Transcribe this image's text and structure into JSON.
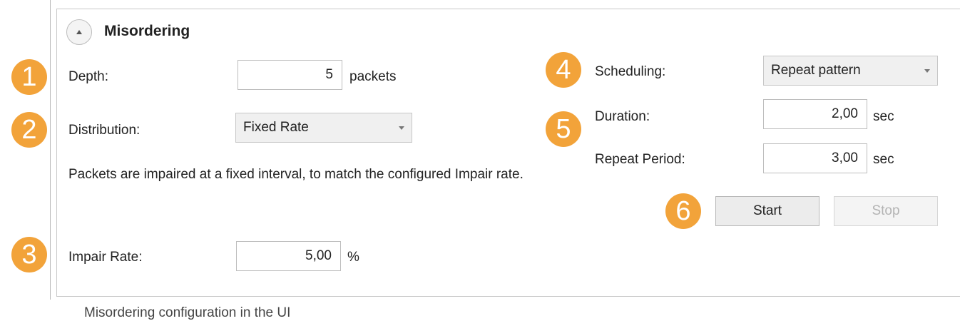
{
  "section": {
    "title": "Misordering",
    "collapse_icon": "chevron-up-icon"
  },
  "depth": {
    "label": "Depth:",
    "value": "5",
    "unit": "packets"
  },
  "distribution": {
    "label": "Distribution:",
    "selected": "Fixed Rate",
    "description": "Packets are impaired at a fixed interval, to match the configured Impair rate."
  },
  "impair_rate": {
    "label": "Impair Rate:",
    "value": "5,00",
    "unit": "%"
  },
  "scheduling": {
    "label": "Scheduling:",
    "selected": "Repeat pattern"
  },
  "duration": {
    "label": "Duration:",
    "value": "2,00",
    "unit": "sec"
  },
  "repeat_period": {
    "label": "Repeat Period:",
    "value": "3,00",
    "unit": "sec"
  },
  "buttons": {
    "start": "Start",
    "stop": "Stop"
  },
  "badges": [
    "1",
    "2",
    "3",
    "4",
    "5",
    "6"
  ],
  "badge_color": "#f2a33a",
  "caption": "Misordering configuration in the UI"
}
